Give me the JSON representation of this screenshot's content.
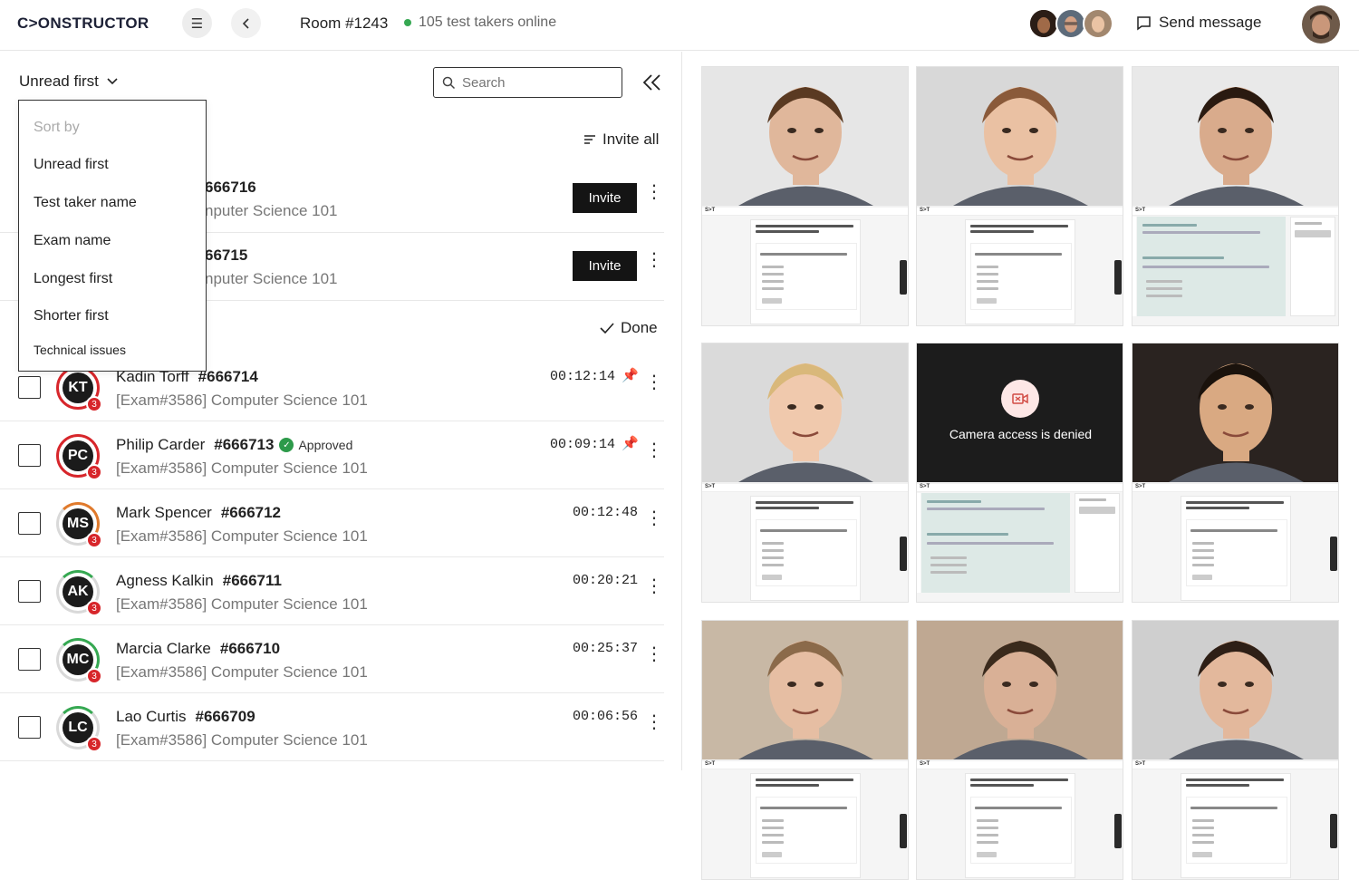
{
  "header": {
    "logo": "C>ONSTRUCTOR",
    "room": "Room #1243",
    "online": "105 test takers online",
    "send_message": "Send message"
  },
  "list": {
    "sort_label": "Unread first",
    "search_placeholder": "Search",
    "invite_all": "Invite all",
    "done": "Done",
    "invite_label": "Invite",
    "sort_menu": {
      "header": "Sort by",
      "items": [
        "Unread first",
        "Test taker name",
        "Exam name",
        "Longest first",
        "Shorter first",
        "Technical issues"
      ]
    },
    "pending": [
      {
        "id": "666716",
        "exam": "nputer Science 101"
      },
      {
        "id": "66715",
        "exam": "nputer Science 101"
      }
    ],
    "rows": [
      {
        "initials": "KT",
        "name": "Kadin Torff",
        "id": "#666714",
        "exam": "[Exam#3586] Computer Science 101",
        "time": "00:12:14",
        "badge": "3",
        "pinned": true,
        "approved": ""
      },
      {
        "initials": "PC",
        "name": "Philip Carder",
        "id": "#666713",
        "exam": "[Exam#3586] Computer Science 101",
        "time": "00:09:14",
        "badge": "3",
        "pinned": true,
        "approved": "Approved"
      },
      {
        "initials": "MS",
        "name": "Mark Spencer",
        "id": "#666712",
        "exam": "[Exam#3586] Computer Science 101",
        "time": "00:12:48",
        "badge": "3",
        "pinned": false,
        "approved": ""
      },
      {
        "initials": "AK",
        "name": "Agness Kalkin",
        "id": "#666711",
        "exam": "[Exam#3586] Computer Science 101",
        "time": "00:20:21",
        "badge": "3",
        "pinned": false,
        "approved": ""
      },
      {
        "initials": "MC",
        "name": "Marcia Clarke",
        "id": "#666710",
        "exam": "[Exam#3586] Computer Science 101",
        "time": "00:25:37",
        "badge": "3",
        "pinned": false,
        "approved": ""
      },
      {
        "initials": "LC",
        "name": "Lao Curtis",
        "id": "#666709",
        "exam": "[Exam#3586] Computer Science 101",
        "time": "00:06:56",
        "badge": "3",
        "pinned": false,
        "approved": ""
      }
    ]
  },
  "grid": {
    "camera_denied": "Camera access is denied",
    "screen_logo": "S>T",
    "tiles": [
      {
        "skin": "#e0b79b",
        "hair": "#5a3a22",
        "bg": "#e6e6e6",
        "screen": "question"
      },
      {
        "skin": "#eac1a3",
        "hair": "#8a5a3a",
        "bg": "#d8d8d8",
        "screen": "question"
      },
      {
        "skin": "#d9ab8c",
        "hair": "#2a1a10",
        "bg": "#e9e9e9",
        "screen": "multiple"
      },
      {
        "skin": "#f0c9ad",
        "hair": "#d9b87a",
        "bg": "#dadada",
        "screen": "question"
      },
      {
        "skin": "",
        "hair": "",
        "bg": "#1c1c1c",
        "screen": "multiple",
        "denied": true
      },
      {
        "skin": "#d9a982",
        "hair": "#1a120c",
        "bg": "#2a2320",
        "screen": "question"
      },
      {
        "skin": "#e6bea3",
        "hair": "#8b6a4a",
        "bg": "#c8b8a5",
        "screen": "question"
      },
      {
        "skin": "#d9b096",
        "hair": "#3a2a1c",
        "bg": "#bfa892",
        "screen": "question"
      },
      {
        "skin": "#e3b89c",
        "hair": "#2e1f16",
        "bg": "#cfcfcf",
        "screen": "question"
      }
    ]
  },
  "colors": {
    "accent": "#141414",
    "online": "#36a852",
    "badge": "#d7262b",
    "approved": "#2d9a4a"
  }
}
